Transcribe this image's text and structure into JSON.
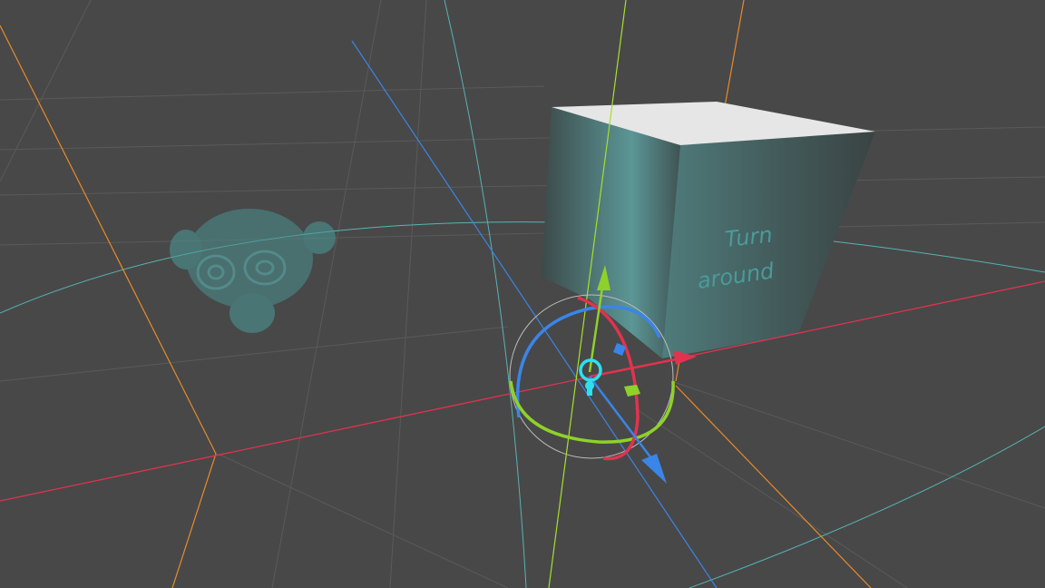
{
  "viewport": {
    "background": "#484848",
    "cube_text": {
      "line1": "Turn",
      "line2": "around"
    },
    "axis_colors": {
      "x": "#e0334f",
      "y": "#8fd12a",
      "z": "#3a85e8",
      "grid_orange": "#e88a2a",
      "grid_cyan": "#5cc6c6"
    },
    "objects": [
      "cube",
      "monkey-head",
      "light",
      "transform-gizmo"
    ]
  }
}
